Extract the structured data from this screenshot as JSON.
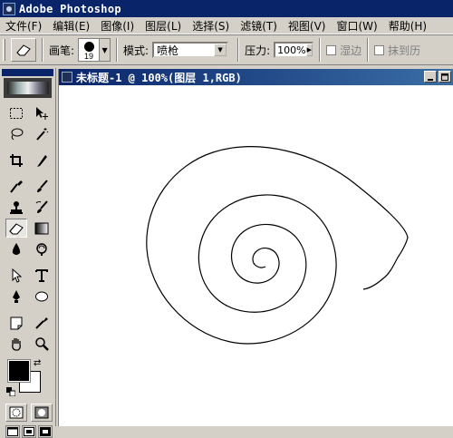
{
  "app": {
    "title": "Adobe Photoshop"
  },
  "menu": {
    "items": [
      "文件(F)",
      "编辑(E)",
      "图像(I)",
      "图层(L)",
      "选择(S)",
      "滤镜(T)",
      "视图(V)",
      "窗口(W)",
      "帮助(H)"
    ]
  },
  "options": {
    "brush_label": "画笔:",
    "brush_size": "19",
    "mode_label": "模式:",
    "mode_value": "喷枪",
    "pressure_label": "压力:",
    "pressure_value": "100%",
    "wet_edges_label": "湿边",
    "erase_history_label": "抹到历"
  },
  "document": {
    "title": "未标题-1 @ 100%(图层 1,RGB)"
  },
  "icons": {
    "eraser": "eraser-icon",
    "marquee": "marquee-icon",
    "move": "move-icon",
    "lasso": "lasso-icon",
    "magic_wand": "magic-wand-icon",
    "crop": "crop-icon",
    "slice": "slice-icon",
    "healing": "healing-brush-icon",
    "brush": "brush-icon",
    "clone": "clone-stamp-icon",
    "history_brush": "history-brush-icon",
    "gradient": "gradient-icon",
    "blur": "blur-icon",
    "dodge": "dodge-icon",
    "path_select": "path-selection-icon",
    "type": "type-icon",
    "pen": "pen-icon",
    "shape": "ellipse-icon",
    "notes": "notes-icon",
    "eyedropper": "eyedropper-icon",
    "hand": "hand-icon",
    "zoom": "zoom-icon"
  },
  "colors": {
    "title_bar": "#0a246a",
    "chrome": "#d4d0c8",
    "foreground": "#000000",
    "background": "#ffffff"
  }
}
